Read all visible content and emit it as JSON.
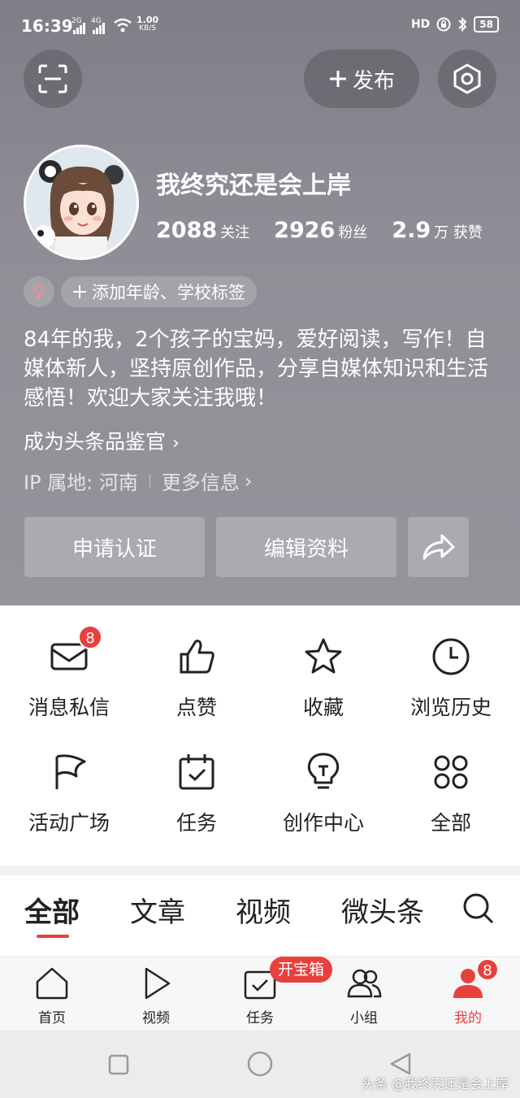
{
  "status_bar": {
    "time": "16:39",
    "signal1": "2G",
    "signal2": "4G",
    "net_speed": "1.00",
    "net_unit": "KB/S",
    "hd_label": "HD",
    "battery": "58"
  },
  "header": {
    "publish_label": "发布"
  },
  "profile": {
    "name": "我终究还是会上岸",
    "stats": [
      {
        "value": "2088",
        "label": "关注"
      },
      {
        "value": "2926",
        "label": "粉丝"
      },
      {
        "value": "2.9",
        "label": "万 获赞"
      }
    ],
    "gender_symbol": "♀",
    "tag_label": "添加年龄、学校标签",
    "bio": "84年的我，2个孩子的宝妈，爱好阅读，写作！自媒体新人，坚持原创作品，分享自媒体知识和生活感悟！欢迎大家关注我哦！",
    "judge_label": "成为头条品鉴官",
    "ip_label": "IP 属地: 河南",
    "more_info": "更多信息",
    "apply_cert": "申请认证",
    "edit_profile": "编辑资料"
  },
  "menu": {
    "items": [
      {
        "label": "消息私信",
        "icon": "mail-icon",
        "badge": "8"
      },
      {
        "label": "点赞",
        "icon": "thumbs-up-icon"
      },
      {
        "label": "收藏",
        "icon": "star-icon"
      },
      {
        "label": "浏览历史",
        "icon": "clock-icon"
      },
      {
        "label": "活动广场",
        "icon": "flag-icon"
      },
      {
        "label": "任务",
        "icon": "calendar-check-icon"
      },
      {
        "label": "创作中心",
        "icon": "lightbulb-icon"
      },
      {
        "label": "全部",
        "icon": "grid-icon"
      }
    ]
  },
  "tabs": [
    {
      "label": "全部"
    },
    {
      "label": "文章"
    },
    {
      "label": "视频"
    },
    {
      "label": "微头条"
    }
  ],
  "bottom_nav": {
    "items": [
      {
        "label": "首页",
        "icon": "home-icon"
      },
      {
        "label": "视频",
        "icon": "play-icon"
      },
      {
        "label": "任务",
        "icon": "task-icon"
      },
      {
        "label": "小组",
        "icon": "group-icon"
      },
      {
        "label": "我的",
        "icon": "profile-icon"
      }
    ],
    "treasure_label": "开宝箱",
    "mine_badge": "8",
    "active_color": "#e8403d"
  },
  "watermark": "头条 @我终究还是会上岸"
}
